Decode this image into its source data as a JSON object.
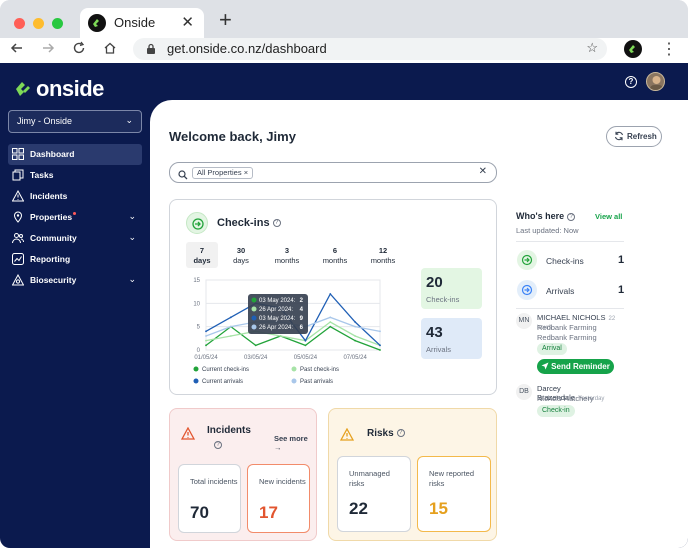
{
  "browser": {
    "tab_title": "Onside",
    "tab_close": "✕",
    "new_tab": "+",
    "url": "get.onside.co.nz/dashboard"
  },
  "app": {
    "logo": "onside",
    "org_selector": "Jimy - Onside",
    "colors": {
      "sidebar": "#0b1a4e",
      "accent_green": "#16a34a",
      "brand_green": "#7ed957"
    }
  },
  "sidebar": {
    "items": [
      {
        "label": "Dashboard",
        "icon": "dashboard-icon",
        "active": true
      },
      {
        "label": "Tasks",
        "icon": "tasks-icon"
      },
      {
        "label": "Incidents",
        "icon": "warning-icon"
      },
      {
        "label": "Properties",
        "icon": "location-pin-icon",
        "has_dot": true,
        "expandable": true
      },
      {
        "label": "Community",
        "icon": "people-icon",
        "expandable": true
      },
      {
        "label": "Reporting",
        "icon": "chart-icon"
      },
      {
        "label": "Biosecurity",
        "icon": "biosecurity-icon",
        "expandable": true
      }
    ]
  },
  "main": {
    "welcome": "Welcome back, Jimy",
    "refresh_label": "Refresh",
    "search": {
      "chip": "All Properties"
    },
    "checkins": {
      "title": "Check-ins",
      "ranges": [
        {
          "top": "7",
          "bottom": "days",
          "active": true
        },
        {
          "top": "30",
          "bottom": "days"
        },
        {
          "top": "3",
          "bottom": "months"
        },
        {
          "top": "6",
          "bottom": "months"
        },
        {
          "top": "12",
          "bottom": "months"
        }
      ],
      "stats": {
        "checkins_value": "20",
        "checkins_label": "Check-ins",
        "arrivals_value": "43",
        "arrivals_label": "Arrivals"
      }
    },
    "incidents": {
      "title": "Incidents",
      "see_more": "See more",
      "total_label": "Total incidents",
      "total_value": "70",
      "new_label": "New incidents",
      "new_value": "17"
    },
    "risks": {
      "title": "Risks",
      "unmanaged_label": "Unmanaged risks",
      "unmanaged_value": "22",
      "new_label": "New reported risks",
      "new_value": "15"
    },
    "whos_here": {
      "title": "Who's here",
      "view_all": "View all",
      "updated": "Last updated: Now",
      "checkins_label": "Check-ins",
      "checkins_value": "1",
      "arrivals_label": "Arrivals",
      "arrivals_value": "1",
      "people": [
        {
          "initials": "MN",
          "name": "MICHAEL NICHOLS",
          "time": "22 hours",
          "org1": "Redbank Farming",
          "org2": "Redbank Farming",
          "status": "Arrival",
          "action": "Send Reminder"
        },
        {
          "initials": "DB",
          "name": "Darcey Brazendale",
          "time": "Yesterday",
          "org1": "Nichols Hatchery",
          "status": "Check-in"
        }
      ]
    }
  },
  "chart_data": {
    "type": "line",
    "x": [
      "01/05/24",
      "02/05/24",
      "03/05/24",
      "04/05/24",
      "05/05/24",
      "06/05/24",
      "07/05/24",
      "08/05/24"
    ],
    "x_tick_labels": [
      "01/05/24",
      "03/05/24",
      "05/05/24",
      "07/05/24"
    ],
    "ylim": [
      0,
      15
    ],
    "y_ticks": [
      0,
      5,
      10,
      15
    ],
    "grid": true,
    "series": [
      {
        "name": "Current check-ins",
        "color": "#22a33a",
        "values": [
          1,
          5,
          1,
          3,
          1,
          5,
          2,
          0
        ]
      },
      {
        "name": "Past check-ins",
        "color": "#a7e3a7",
        "values": [
          2,
          3,
          4,
          3,
          2,
          6,
          3,
          1
        ]
      },
      {
        "name": "Current arrivals",
        "color": "#1f5fb5",
        "values": [
          4,
          7,
          10,
          9,
          2,
          12,
          6,
          1
        ]
      },
      {
        "name": "Past arrivals",
        "color": "#a9c7ea",
        "values": [
          3,
          5,
          6,
          6,
          5,
          7,
          5,
          4
        ]
      }
    ],
    "tooltip": [
      {
        "label": "03 May 2024:",
        "value": "2",
        "color": "#22a33a"
      },
      {
        "label": "26 Apr 2024:",
        "value": "4",
        "color": "#a7e3a7"
      },
      {
        "label": "03 May 2024:",
        "value": "9",
        "color": "#1f5fb5"
      },
      {
        "label": "26 Apr 2024:",
        "value": "6",
        "color": "#a9c7ea"
      }
    ]
  }
}
